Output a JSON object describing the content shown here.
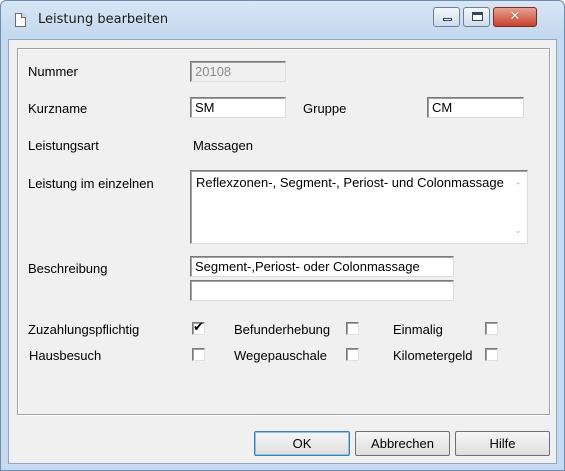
{
  "window": {
    "title": "Leistung bearbeiten"
  },
  "form": {
    "nummer": {
      "label": "Nummer",
      "value": "20108"
    },
    "kurzname": {
      "label": "Kurzname",
      "value": "SM"
    },
    "gruppe": {
      "label": "Gruppe",
      "value": "CM"
    },
    "leistungsart": {
      "label": "Leistungsart",
      "value": "Massagen"
    },
    "leistung_im_einzelnen": {
      "label": "Leistung im einzelnen",
      "value": "Reflexzonen-, Segment-, Periost- und Colonmassage"
    },
    "beschreibung": {
      "label": "Beschreibung",
      "line1": "Segment-,Periost- oder Colonmassage",
      "line2": ""
    }
  },
  "checkboxes": [
    {
      "label": "Zuzahlungspflichtig",
      "checked": true
    },
    {
      "label": "Befunderhebung",
      "checked": false
    },
    {
      "label": "Einmalig",
      "checked": false
    },
    {
      "label": "Hausbesuch",
      "checked": false
    },
    {
      "label": "Wegepauschale",
      "checked": false
    },
    {
      "label": "Kilometergeld",
      "checked": false
    }
  ],
  "buttons": {
    "ok": "OK",
    "cancel": "Abbrechen",
    "help": "Hilfe"
  },
  "checkmark_glyph": "✔"
}
